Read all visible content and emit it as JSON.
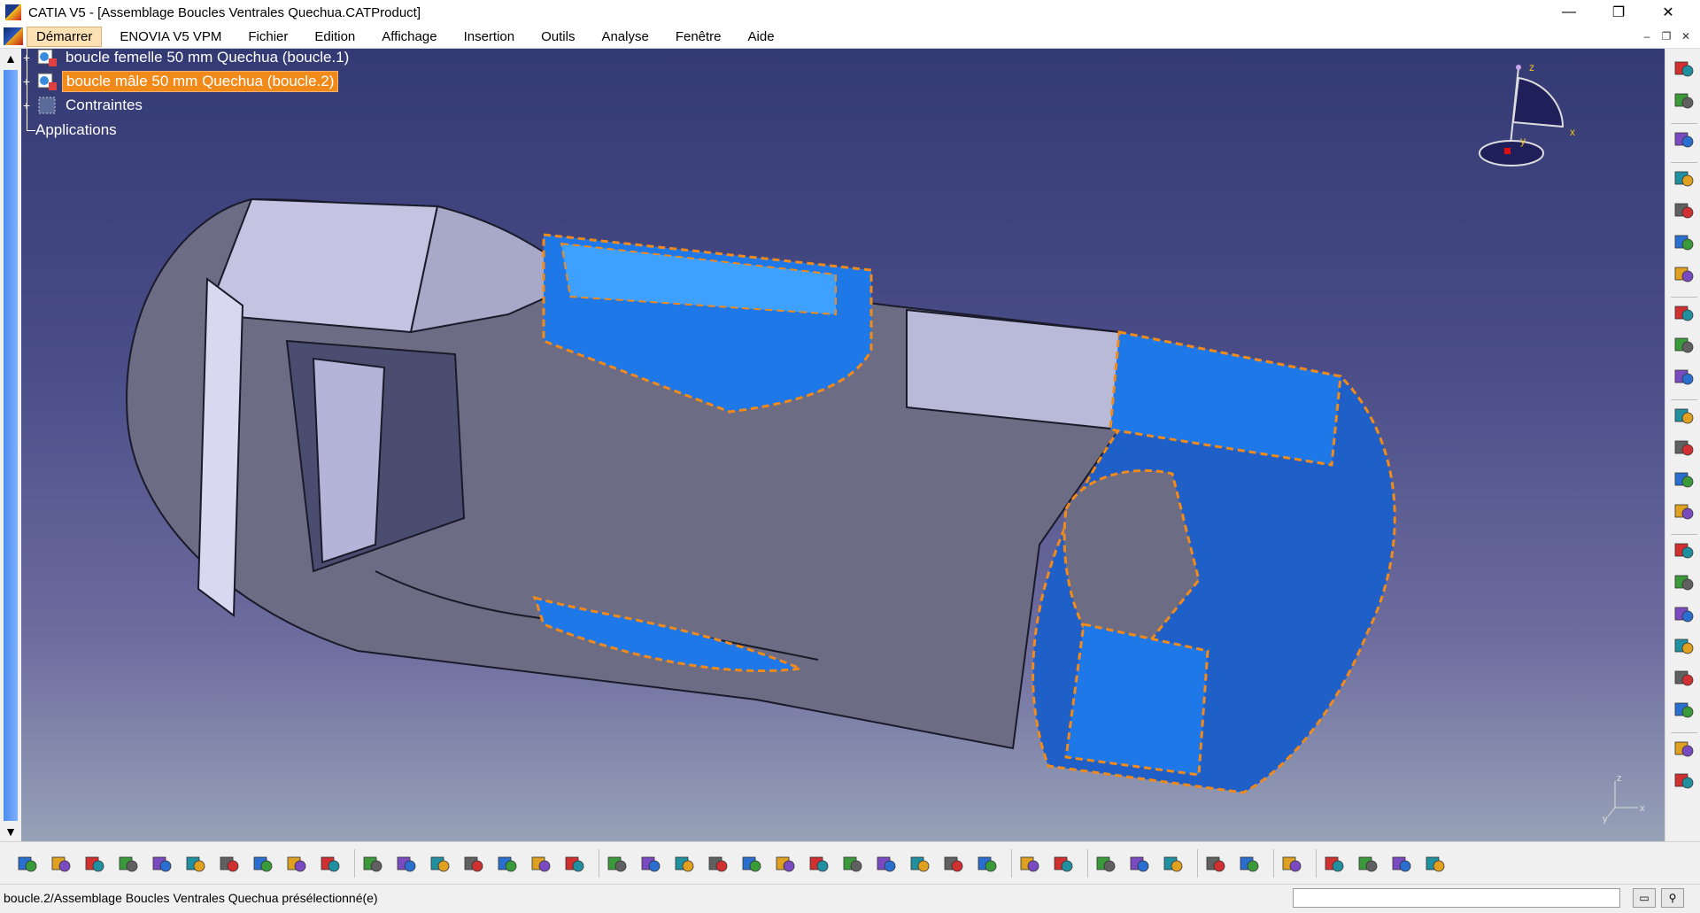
{
  "window": {
    "title": "CATIA V5 - [Assemblage Boucles Ventrales Quechua.CATProduct]",
    "controls": [
      "—",
      "❐",
      "✕"
    ]
  },
  "menubar": {
    "items": [
      "Démarrer",
      "ENOVIA V5 VPM",
      "Fichier",
      "Edition",
      "Affichage",
      "Insertion",
      "Outils",
      "Analyse",
      "Fenêtre",
      "Aide"
    ],
    "active": "Démarrer",
    "mdi_controls": [
      "–",
      "❐",
      "✕"
    ]
  },
  "tree": {
    "nodes": [
      {
        "label": "boucle femelle 50 mm Quechua (boucle.1)",
        "selected": false
      },
      {
        "label": "boucle mâle 50 mm Quechua (boucle.2)",
        "selected": true
      },
      {
        "label": "Contraintes",
        "selected": false
      },
      {
        "label": "Applications",
        "selected": false
      }
    ]
  },
  "compass": {
    "axes": [
      "z",
      "x",
      "y"
    ]
  },
  "axis_triad": {
    "axes": [
      "z",
      "x",
      "y"
    ]
  },
  "colors": {
    "selection_orange": "#f28a1a",
    "part_blue": "#1f78e8",
    "background_top": "#343a73",
    "background_bottom": "#97a2b8"
  },
  "statusbar": {
    "text": "boucle.2/Assemblage Boucles Ventrales Quechua présélectionné(e)",
    "command_input": ""
  },
  "bottom_toolbar": {
    "icons": [
      "new-icon",
      "open-icon",
      "save-icon",
      "print-icon",
      "cut-icon",
      "copy-icon",
      "paste-icon",
      "undo-icon",
      "redo-icon",
      "whats-this-icon",
      "formula-icon",
      "comment-icon",
      "knowledge-icon",
      "table-icon",
      "product-structure-icon",
      "catalog-icon",
      "tools-icon",
      "fly-mode-icon",
      "fit-all-icon",
      "pan-icon",
      "rotate-icon",
      "zoom-in-icon",
      "zoom-out-icon",
      "normal-view-icon",
      "multi-view-icon",
      "iso-view-icon",
      "render-style-icon",
      "hide-show-icon",
      "swap-space-icon",
      "snapshot-icon",
      "measure-icon",
      "sectioning-icon",
      "clash-icon",
      "update-icon",
      "refresh-icon",
      "plane-icon",
      "apply-material-icon",
      "photo-studio-icon",
      "color-icon",
      "grid-icon",
      "catia-logo-icon"
    ]
  },
  "right_toolbar": {
    "icons": [
      "compass-tool-icon",
      "select-arrow-icon",
      "product-icon",
      "insert-component-icon",
      "existing-component-icon",
      "replace-icon",
      "graph-tree-icon",
      "new-part-icon",
      "import-icon",
      "publish-icon",
      "move-icon",
      "snap-icon",
      "manipulate-icon",
      "explode-icon",
      "constraint-coincidence-icon",
      "constraint-contact-icon",
      "constraint-offset-icon",
      "constraint-angle-icon",
      "fix-icon",
      "fix-together-icon",
      "quick-constraint-icon",
      "flexible-icon"
    ]
  }
}
